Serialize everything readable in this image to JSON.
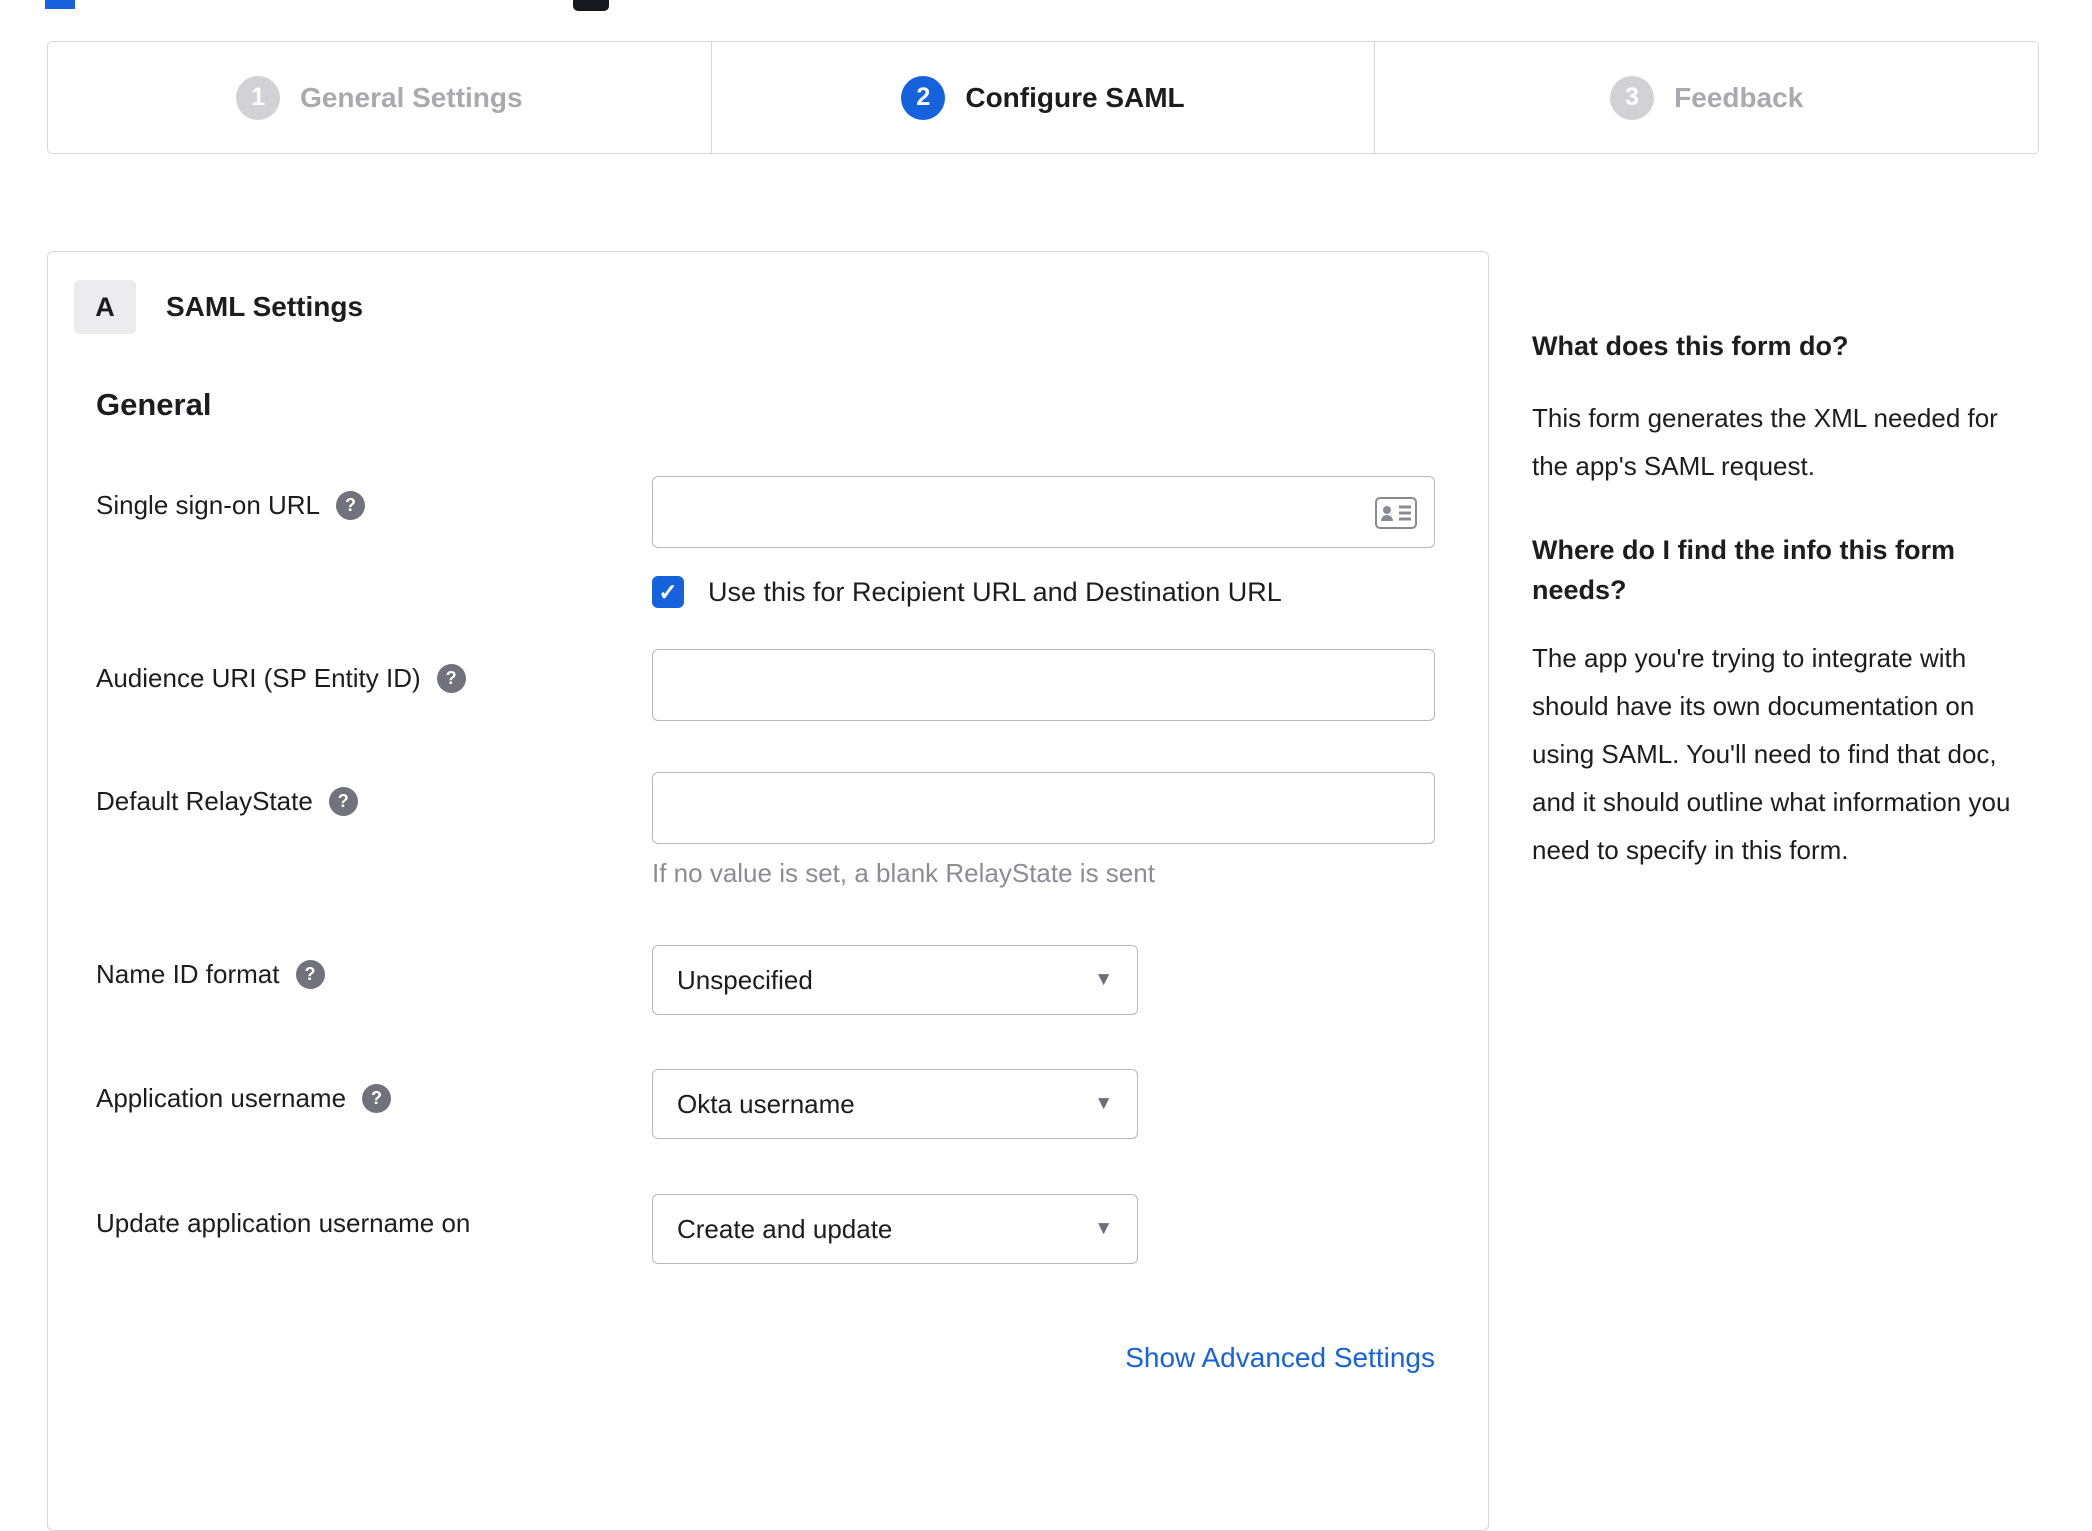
{
  "steps": [
    {
      "number": "1",
      "label": "General Settings",
      "active": false
    },
    {
      "number": "2",
      "label": "Configure SAML",
      "active": true
    },
    {
      "number": "3",
      "label": "Feedback",
      "active": false
    }
  ],
  "form": {
    "badge": "A",
    "title": "SAML Settings",
    "section_general": "General",
    "sso_label": "Single sign-on URL",
    "sso_value": "",
    "sso_checkbox_label": "Use this for Recipient URL and Destination URL",
    "sso_checkbox_checked": true,
    "audience_label": "Audience URI (SP Entity ID)",
    "audience_value": "",
    "relay_label": "Default RelayState",
    "relay_value": "",
    "relay_hint": "If no value is set, a blank RelayState is sent",
    "nameid_label": "Name ID format",
    "nameid_value": "Unspecified",
    "app_username_label": "Application username",
    "app_username_value": "Okta username",
    "update_username_label": "Update application username on",
    "update_username_value": "Create and update",
    "advanced_link": "Show Advanced Settings"
  },
  "help_panel": {
    "heading1": "What does this form do?",
    "body1": "This form generates the XML needed for the app's SAML request.",
    "heading2": "Where do I find the info this form needs?",
    "body2": "The app you're trying to integrate with should have its own documentation on using SAML. You'll need to find that doc, and it should outline what information you need to specify in this form."
  },
  "icons": {
    "help": "?",
    "checkmark": "✓",
    "caret": "▼",
    "contact_card": "contact-card"
  },
  "colors": {
    "accent_blue": "#1662dd",
    "link_blue": "#1662dd",
    "inactive_gray": "#d2d2d6",
    "border_gray": "#d8d8dc"
  }
}
